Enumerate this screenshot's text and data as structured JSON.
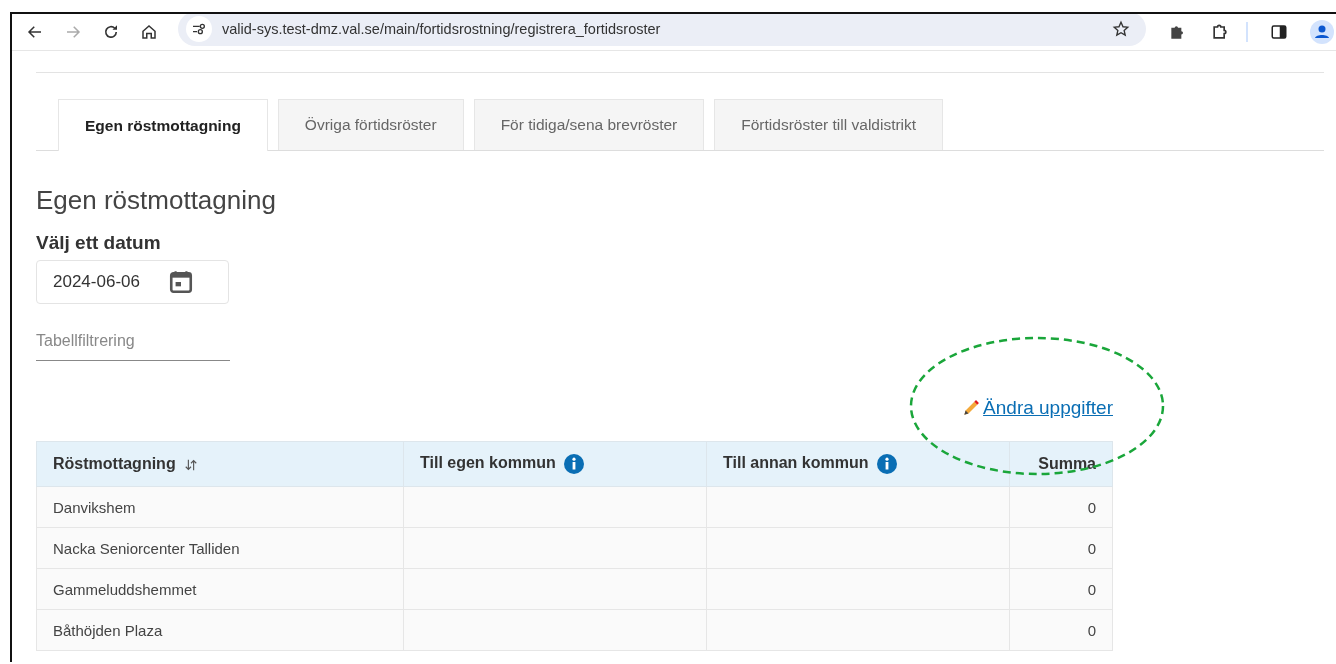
{
  "browser": {
    "url": "valid-sys.test-dmz.val.se/main/fortidsrostning/registrera_fortidsroster",
    "back_disabled": false,
    "forward_disabled": true
  },
  "tabs": [
    {
      "label": "Egen röstmottagning",
      "selected": true
    },
    {
      "label": "Övriga förtidsröster",
      "selected": false
    },
    {
      "label": "För tidiga/sena brevröster",
      "selected": false
    },
    {
      "label": "Förtidsröster till valdistrikt",
      "selected": false
    }
  ],
  "heading": "Egen röstmottagning",
  "date_picker": {
    "label": "Välj ett datum",
    "value": "2024-06-06"
  },
  "filter": {
    "placeholder": "Tabellfiltrering"
  },
  "edit_link": {
    "label": "Ändra uppgifter",
    "circled": true
  },
  "table": {
    "columns": [
      {
        "label": "Röstmottagning",
        "kind": "sortable"
      },
      {
        "label": "Till egen kommun",
        "kind": "info"
      },
      {
        "label": "Till annan kommun",
        "kind": "info"
      },
      {
        "label": "Summa",
        "kind": "numeric"
      }
    ],
    "rows": [
      {
        "name": "Danvikshem",
        "summa": "0"
      },
      {
        "name": "Nacka Seniorcenter Talliden",
        "summa": "0"
      },
      {
        "name": "Gammeluddshemmet",
        "summa": "0"
      },
      {
        "name": "Båthöjden Plaza",
        "summa": "0"
      }
    ]
  }
}
